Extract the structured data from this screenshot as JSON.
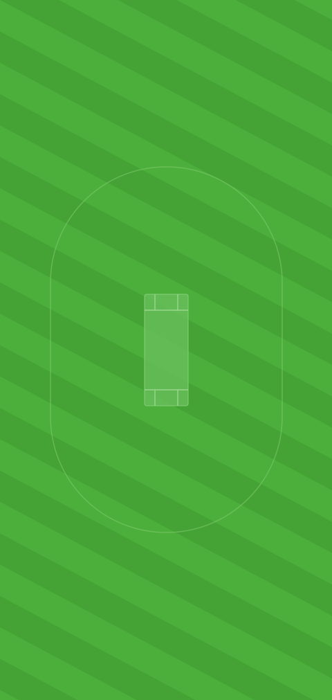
{
  "field": {
    "grass_light": "#4caf3c",
    "grass_dark": "#45a336",
    "line_color": "#7fcc6e",
    "pitch_color": "#66bd59",
    "pitch_border": "#86cf79"
  }
}
